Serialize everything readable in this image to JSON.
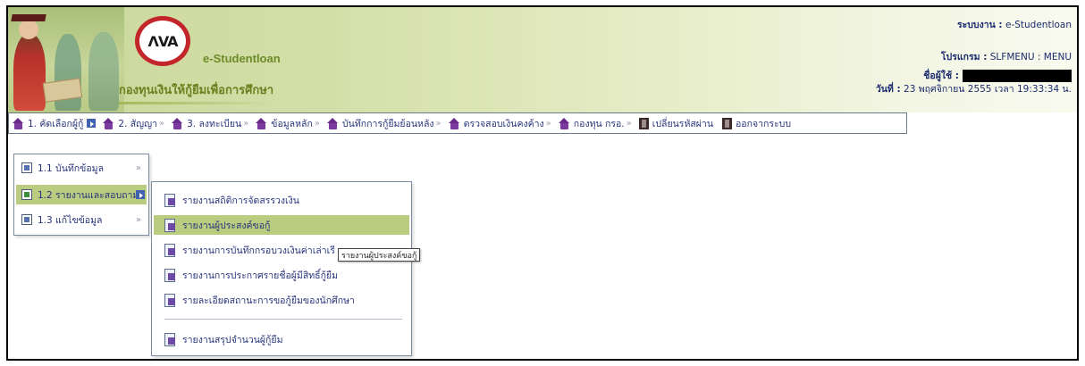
{
  "header": {
    "brand_suffix": "-Studentloan",
    "brand_title": "กองทุนเงินให้กู้ยืมเพื่อการศึกษา",
    "system_label": "ระบบงาน :",
    "system_value": "e-Studentloan",
    "program_label": "โปรแกรม :",
    "program_value": "SLFMENU : MENU",
    "user_label": "ชื่อผู้ใช้ :",
    "date_label": "วันที่ :",
    "date_value": "23 พฤศจิกายน 2555 เวลา 19:33:34 น."
  },
  "menubar": {
    "items": [
      {
        "label": "1. คัดเลือกผู้กู้",
        "icon": "house-icon"
      },
      {
        "label": "2. สัญญา",
        "icon": "house-icon"
      },
      {
        "label": "3. ลงทะเบียน",
        "icon": "house-icon"
      },
      {
        "label": "ข้อมูลหลัก",
        "icon": "house-icon"
      },
      {
        "label": "บันทึกการกู้ยืมย้อนหลัง",
        "icon": "house-icon"
      },
      {
        "label": "ตรวจสอบเงินคงค้าง",
        "icon": "house-icon"
      },
      {
        "label": "กองทุน กรอ.",
        "icon": "house-icon"
      },
      {
        "label": "เปลี่ยนรหัสผ่าน",
        "icon": "door-icon"
      },
      {
        "label": "ออกจากระบบ",
        "icon": "door-icon"
      }
    ]
  },
  "submenu": {
    "items": [
      {
        "label": "1.1 บันทึกข้อมูล"
      },
      {
        "label": "1.2 รายงานและสอบถาม"
      },
      {
        "label": "1.3 แก้ไขข้อมูล"
      }
    ]
  },
  "reports": {
    "items": [
      {
        "label": "รายงานสถิติการจัดสรรวงเงิน"
      },
      {
        "label": "รายงานผู้ประสงค์ขอกู้"
      },
      {
        "label": "รายงานการบันทึกกรอบวงเงินค่าเล่าเรี"
      },
      {
        "label": "รายงานการประกาศรายชื่อผู้มีสิทธิ์กู้ยืม"
      },
      {
        "label": "รายละเอียดสถานะการขอกู้ยืมของนักศึกษา"
      },
      {
        "label": "รายงานสรุปจำนวนผู้กู้ยืม"
      }
    ]
  },
  "tooltip": {
    "text": "รายงานผู้ประสงค์ขอกู้"
  },
  "colors": {
    "menu_highlight": "#b9cc80",
    "header_green": "#c9d79a",
    "text_blue": "#27347a"
  }
}
